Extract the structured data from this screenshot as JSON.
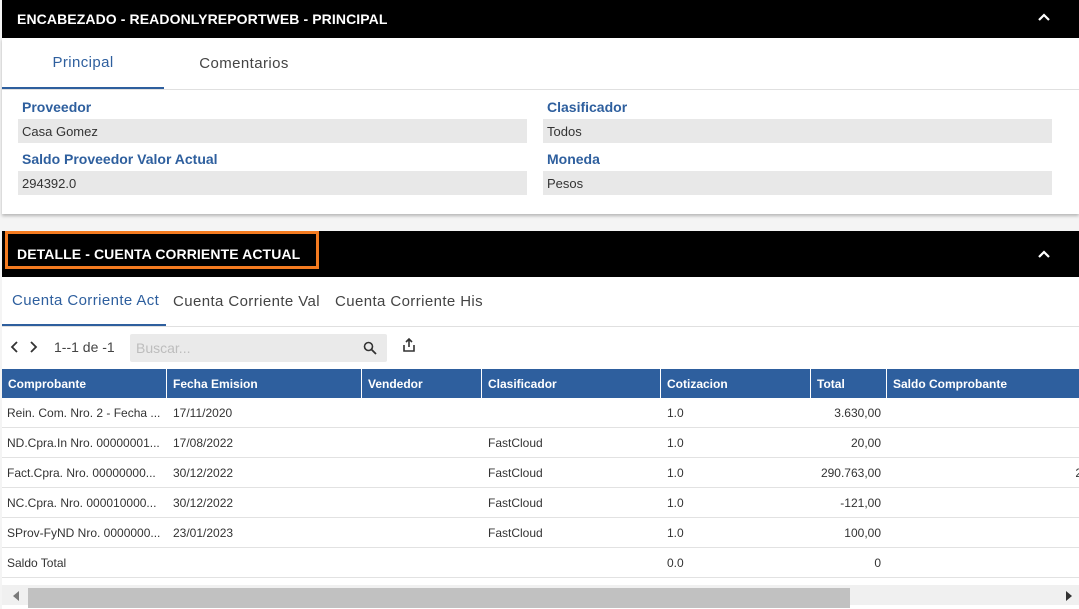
{
  "header": {
    "title": "ENCABEZADO - READONLYREPORTWEB - PRINCIPAL",
    "tabs": [
      {
        "label": "Principal",
        "active": true
      },
      {
        "label": "Comentarios",
        "active": false
      }
    ],
    "fields": {
      "proveedor": {
        "label": "Proveedor",
        "value": "Casa Gomez"
      },
      "clasificador": {
        "label": "Clasificador",
        "value": "Todos"
      },
      "saldo": {
        "label": "Saldo Proveedor Valor Actual",
        "value": "294392.0"
      },
      "moneda": {
        "label": "Moneda",
        "value": "Pesos"
      }
    }
  },
  "detail": {
    "title": "DETALLE - CUENTA CORRIENTE ACTUAL",
    "tabs": [
      {
        "label": "Cuenta Corriente Act",
        "active": true
      },
      {
        "label": "Cuenta Corriente Val",
        "active": false
      },
      {
        "label": "Cuenta Corriente His",
        "active": false
      }
    ],
    "pager_text": "1--1 de -1",
    "search_placeholder": "Buscar...",
    "columns": [
      "Comprobante",
      "Fecha Emision",
      "Vendedor",
      "Clasificador",
      "Cotizacion",
      "Total",
      "Saldo Comprobante"
    ],
    "rows": [
      {
        "comprobante": "Rein. Com. Nro.  2 - Fecha ...",
        "fecha": "17/11/2020",
        "vendedor": "",
        "clasificador": "",
        "cotizacion": "1.0",
        "total": "3.630,00",
        "saldo": ""
      },
      {
        "comprobante": "ND.Cpra.In Nro.  00000001...",
        "fecha": "17/08/2022",
        "vendedor": "",
        "clasificador": "FastCloud",
        "cotizacion": "1.0",
        "total": "20,00",
        "saldo": ""
      },
      {
        "comprobante": "Fact.Cpra. Nro.  00000000...",
        "fecha": "30/12/2022",
        "vendedor": "",
        "clasificador": "FastCloud",
        "cotizacion": "1.0",
        "total": "290.763,00",
        "saldo": "2"
      },
      {
        "comprobante": "NC.Cpra. Nro.  000010000...",
        "fecha": "30/12/2022",
        "vendedor": "",
        "clasificador": "FastCloud",
        "cotizacion": "1.0",
        "total": "-121,00",
        "saldo": ""
      },
      {
        "comprobante": "SProv-FyND Nro.  0000000...",
        "fecha": "23/01/2023",
        "vendedor": "",
        "clasificador": "FastCloud",
        "cotizacion": "1.0",
        "total": "100,00",
        "saldo": ""
      },
      {
        "comprobante": "Saldo Total",
        "fecha": "",
        "vendedor": "",
        "clasificador": "",
        "cotizacion": "0.0",
        "total": "0",
        "saldo": ""
      }
    ]
  },
  "colors": {
    "accent": "#2e5f9e",
    "highlight": "#f47b20",
    "header_bg": "#000000"
  }
}
